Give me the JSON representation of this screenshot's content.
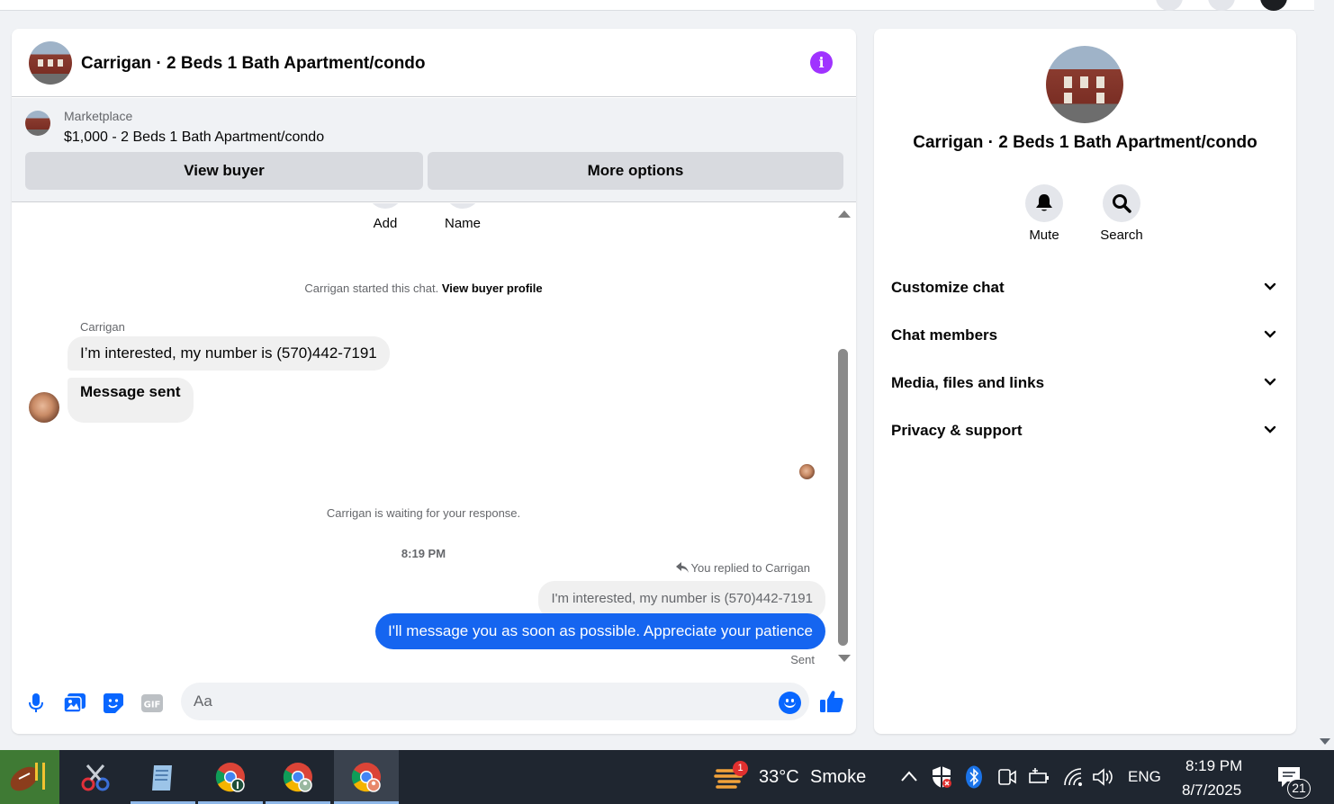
{
  "chat": {
    "title": "Carrigan · 2 Beds 1 Bath Apartment/condo",
    "listing": {
      "label": "Marketplace",
      "price_title": "$1,000 - 2 Beds 1 Bath Apartment/condo",
      "view_buyer_label": "View buyer",
      "more_options_label": "More options"
    },
    "shortcuts": {
      "add_label": "Add",
      "name_label": "Name"
    },
    "started": {
      "text": "Carrigan started this chat.",
      "link": "View buyer profile"
    },
    "sender_name": "Carrigan",
    "incoming": [
      "I’m interested, my number is (570)442-7191",
      "Message sent"
    ],
    "waiting_text": "Carrigan is waiting for your response.",
    "timestamp": "8:19 PM",
    "replied_text": "You replied to Carrigan",
    "quoted_text": "I'm interested, my number is (570)442-7191",
    "outgoing": "I'll message you as soon as possible. Appreciate your patience",
    "sent_status": "Sent",
    "composer": {
      "placeholder": "Aa"
    },
    "icons": [
      "microphone-icon",
      "photo-icon",
      "sticker-icon",
      "gif-icon",
      "emoji-icon",
      "thumbs-up-icon",
      "info-icon"
    ]
  },
  "info_panel": {
    "title": "Carrigan · 2 Beds 1 Bath Apartment/condo",
    "mute_label": "Mute",
    "search_label": "Search",
    "sections": [
      "Customize chat",
      "Chat members",
      "Media, files and links",
      "Privacy & support"
    ]
  },
  "taskbar": {
    "weather_temp": "33°C",
    "weather_desc": "Smoke",
    "weather_badge": "1",
    "language": "ENG",
    "time": "8:19 PM",
    "date": "8/7/2025",
    "notifications": "21"
  },
  "colors": {
    "accent_blue": "#0866ff",
    "outgoing_bubble": "#1565f0",
    "info_purple": "#a033ff",
    "taskbar": "#1f2630"
  }
}
